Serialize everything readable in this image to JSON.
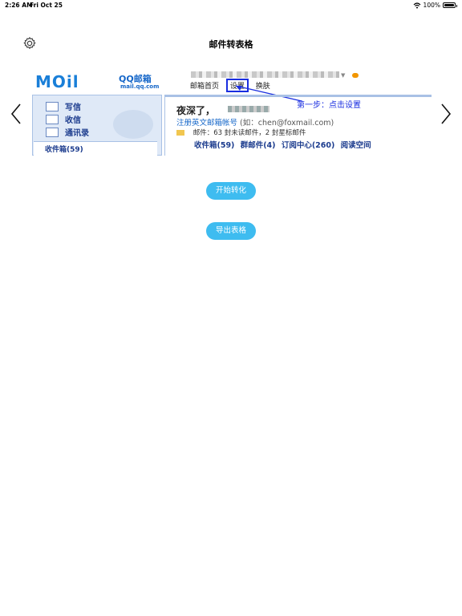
{
  "status_bar": {
    "time": "2:26 AM",
    "date": "Fri Oct 25",
    "battery": "100%"
  },
  "header": {
    "title": "邮件转表格",
    "settings_icon": "gear-icon"
  },
  "carousel": {
    "prev_icon": "chevron-left-icon",
    "next_icon": "chevron-right-icon",
    "image": {
      "brand": "MOil",
      "product": "QQ邮箱",
      "domain": "mail.qq.com",
      "top_links": [
        "邮箱首页",
        "设置",
        "换肤"
      ],
      "step_hint": "第一步：点击设置",
      "sidebar_items": [
        "写信",
        "收信",
        "通讯录"
      ],
      "inbox_label": "收件箱(59)",
      "greeting": "夜深了，",
      "register_text": "注册英文邮箱帐号",
      "register_example": "(如：chen@foxmail.com)",
      "mail_info": "邮件：63 封未读邮件，2 封星标邮件",
      "folders": [
        "收件箱(59)",
        "群邮件(4)",
        "订阅中心(260)",
        "阅读空间"
      ]
    }
  },
  "buttons": {
    "start": "开始转化",
    "export": "导出表格"
  },
  "colors": {
    "button": "#3ebcf0",
    "highlight": "#1a2ee0"
  }
}
